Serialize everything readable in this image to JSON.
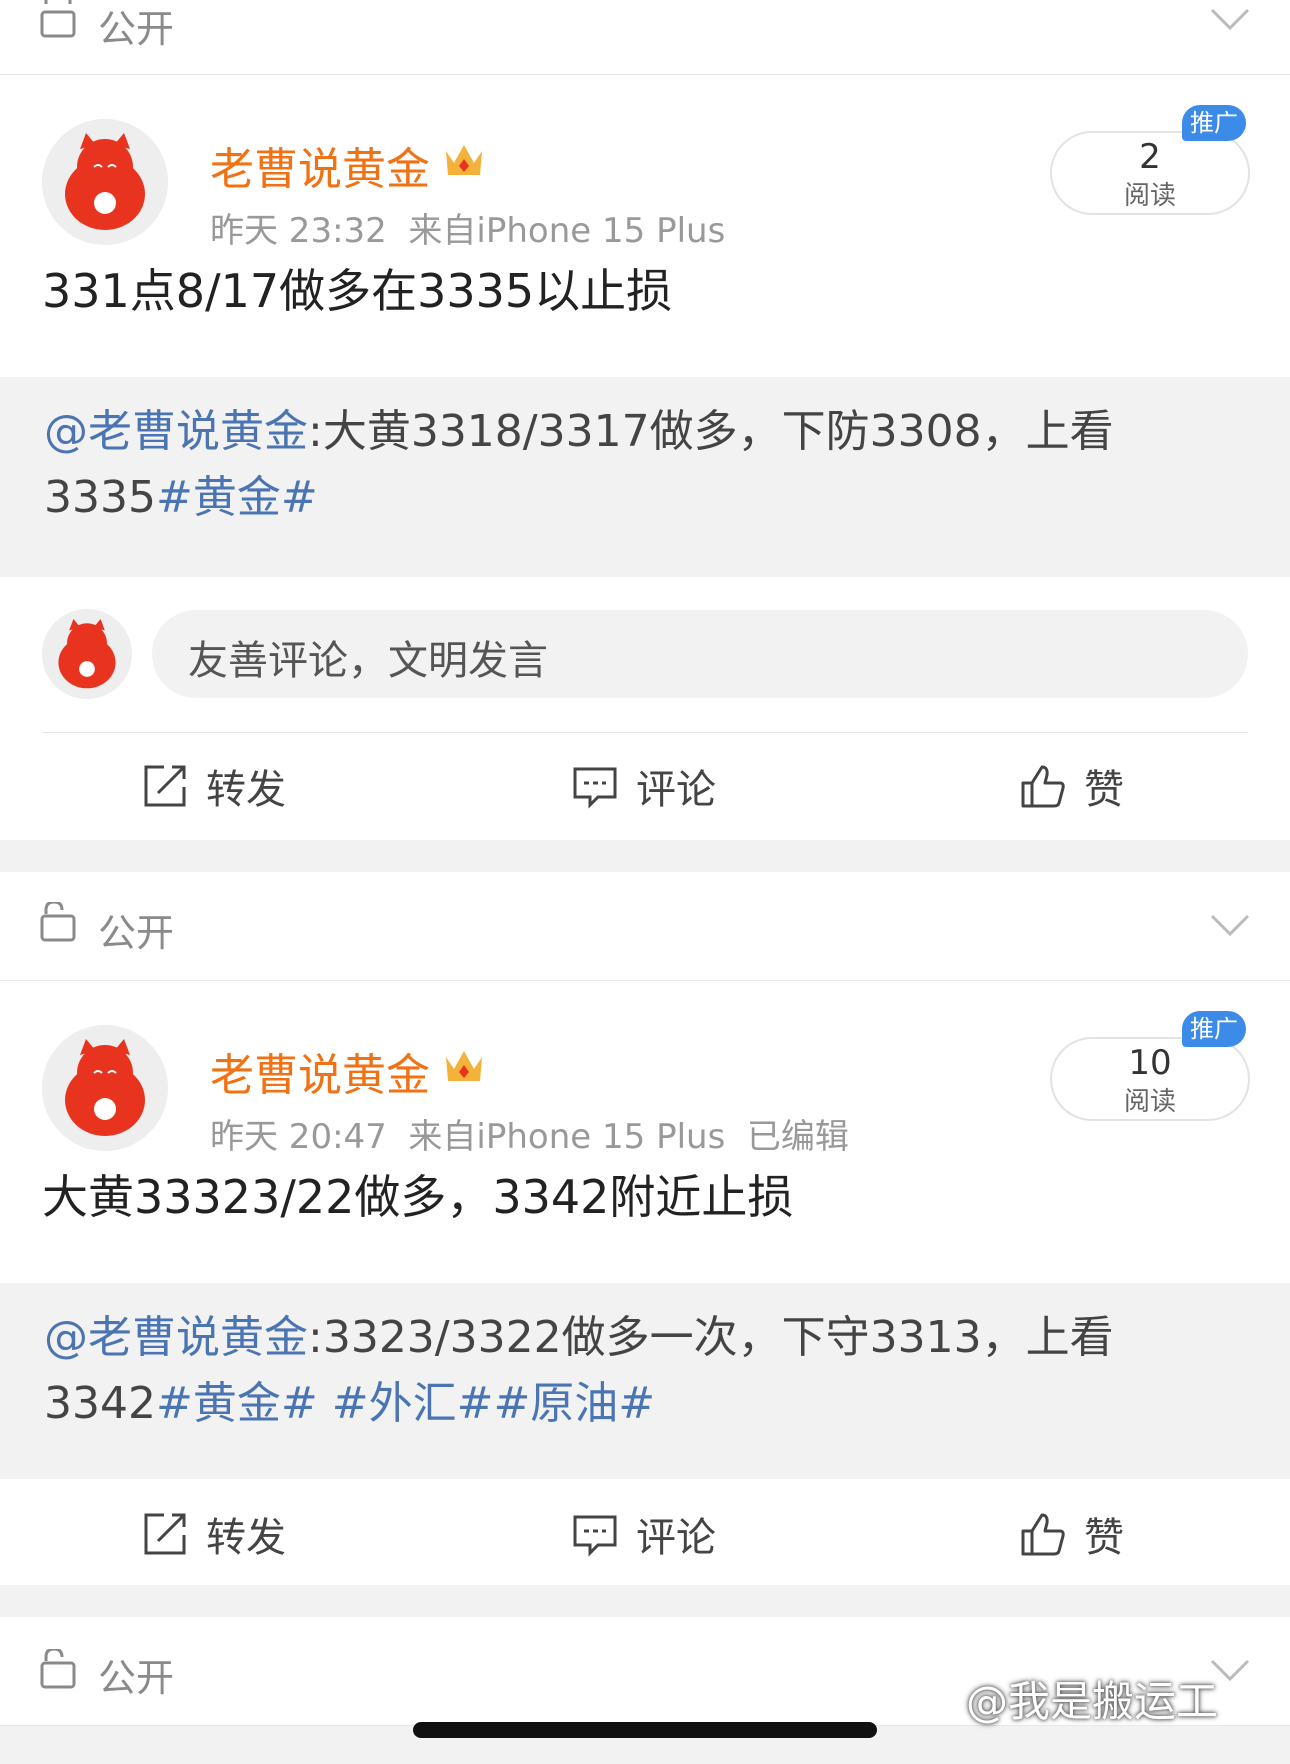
{
  "posts": [
    {
      "visibility": "公开",
      "username": "老曹说黄金",
      "time": "昨天 23:32",
      "source": "来自iPhone 15 Plus",
      "edited": "",
      "promo_label": "推广",
      "reads": "2",
      "reads_label": "阅读",
      "body": "331点8/17做多在3335以止损",
      "quote_mention": "@老曹说黄金",
      "quote_text": ":大黄3318/3317做多，下防3308，上看3335",
      "quote_tags": "#黄金#"
    },
    {
      "visibility": "公开",
      "username": "老曹说黄金",
      "time": "昨天 20:47",
      "source": "来自iPhone 15 Plus",
      "edited": "已编辑",
      "promo_label": "推广",
      "reads": "10",
      "reads_label": "阅读",
      "body": "大黄33323/22做多，3342附近止损",
      "quote_mention": "@老曹说黄金",
      "quote_text": ":3323/3322做多一次，下守3313，上看3342",
      "quote_tags": "#黄金# #外汇##原油#"
    }
  ],
  "comment_placeholder": "友善评论，文明发言",
  "actions": {
    "repost": "转发",
    "comment": "评论",
    "like": "赞"
  },
  "top_visibility": "公开",
  "bottom_visibility": "公开",
  "watermark": "@我是搬运工",
  "colors": {
    "username": "#f07214",
    "link": "#4a74b2",
    "badge": "#3d8be8"
  }
}
